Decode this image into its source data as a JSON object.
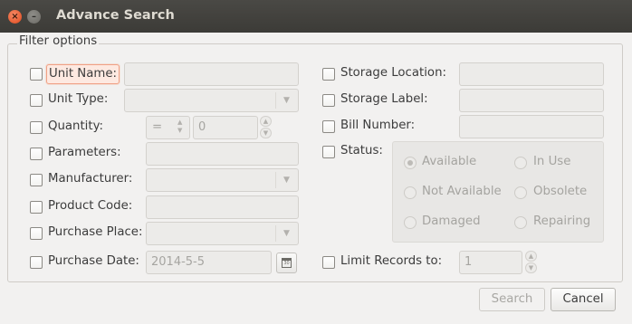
{
  "window": {
    "title": "Advance Search",
    "close_glyph": "×",
    "min_glyph": "–"
  },
  "group": {
    "title": "Filter options"
  },
  "left": {
    "unit_name": "Unit Name:",
    "unit_type": "Unit Type:",
    "quantity": "Quantity:",
    "quantity_op": "=",
    "quantity_value": "0",
    "parameters": "Parameters:",
    "manufacturer": "Manufacturer:",
    "product_code": "Product Code:",
    "purchase_place": "Purchase Place:",
    "purchase_date": "Purchase Date:",
    "purchase_date_value": "2014-5-5",
    "calendar_glyph": "30"
  },
  "right": {
    "storage_location": "Storage Location:",
    "storage_label": "Storage Label:",
    "bill_number": "Bill Number:",
    "status": "Status:",
    "limit_records": "Limit Records to:",
    "limit_value": "1"
  },
  "status_options": {
    "available": "Available",
    "in_use": "In Use",
    "not_available": "Not Available",
    "obsolete": "Obsolete",
    "damaged": "Damaged",
    "repairing": "Repairing",
    "selected": "Available"
  },
  "buttons": {
    "search": "Search",
    "cancel": "Cancel"
  },
  "icons": {
    "dropdown": "▼",
    "spin_up": "▲",
    "spin_down": "▼",
    "spin_small_up": "⌃",
    "spin_small_down": "⌄"
  }
}
